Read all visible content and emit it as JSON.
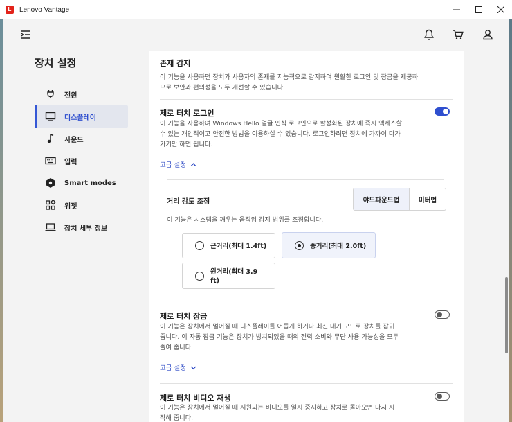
{
  "window": {
    "title": "Lenovo Vantage",
    "logo_letter": "L"
  },
  "sidebar": {
    "title": "장치 설정",
    "items": [
      {
        "label": "전원",
        "icon": "plug-icon"
      },
      {
        "label": "디스플레이",
        "icon": "monitor-icon",
        "active": true
      },
      {
        "label": "사운드",
        "icon": "music-note-icon"
      },
      {
        "label": "입력",
        "icon": "keyboard-icon"
      },
      {
        "label": "Smart modes",
        "icon": "hexagon-icon"
      },
      {
        "label": "위젯",
        "icon": "widgets-icon"
      },
      {
        "label": "장치 세부 정보",
        "icon": "laptop-icon"
      }
    ]
  },
  "presence": {
    "title": "존재 감지",
    "desc1": "이 기능을 사용하면 장치가 사용자의 존재를 지능적으로 감지하여 원활한 로그인 및 잠금을 제공하",
    "desc2": "므로 보안과 편의성을 모두 개선할 수 있습니다."
  },
  "zero_touch_login": {
    "title": "제로 터치 로그인",
    "enabled": true,
    "desc1": "이 기능을 사용하여 Windows Hello 얼굴 인식 로그인으로 활성화된 장치에 즉시 액세스할",
    "desc2": "수 있는 개인적이고 안전한 방법을 이용하실 수 있습니다. 로그인하려면 장치에 가까이 다가",
    "desc3": "가기만 하면 됩니다.",
    "advanced_label": "고급 설정",
    "distance": {
      "label": "거리 감도 조정",
      "unit_options": [
        "야드파운드법",
        "미터법"
      ],
      "unit_selected": "야드파운드법",
      "desc": "이 기능은 시스템을 깨우는 움직임 감지 범위를 조정합니다.",
      "options": [
        {
          "label": "근거리(최대 1.4ft)"
        },
        {
          "label": "중거리(최대 2.0ft)",
          "selected": true
        },
        {
          "label_line1": "원거리(최대 3.9",
          "label_line2": "ft)"
        }
      ]
    }
  },
  "zero_touch_lock": {
    "title": "제로 터치 잠금",
    "enabled": false,
    "desc1": "이 기능은 장치에서 멀어질 때 디스플레이를 어둡게 하거나 최신 대기 모드로 장치를 잠귀",
    "desc2": "줍니다. 이 자동 잠금 기능은 장치가 방치되었을 때의 전력 소비와 무단 사용 가능성을 모두",
    "desc3": "줄여 줍니다.",
    "advanced_label": "고급 설정"
  },
  "zero_touch_video": {
    "title": "제로 터치 비디오 재생",
    "enabled": false,
    "desc1": "이 기능은 장치에서 멀어질 때 지원되는 비디오를 일시 중지하고 장치로 돌아오면 다시 시",
    "desc2": "작해 줍니다."
  },
  "colors": {
    "accent": "#2f4fcf",
    "link": "#2947c4",
    "brand_red": "#e2231a"
  }
}
